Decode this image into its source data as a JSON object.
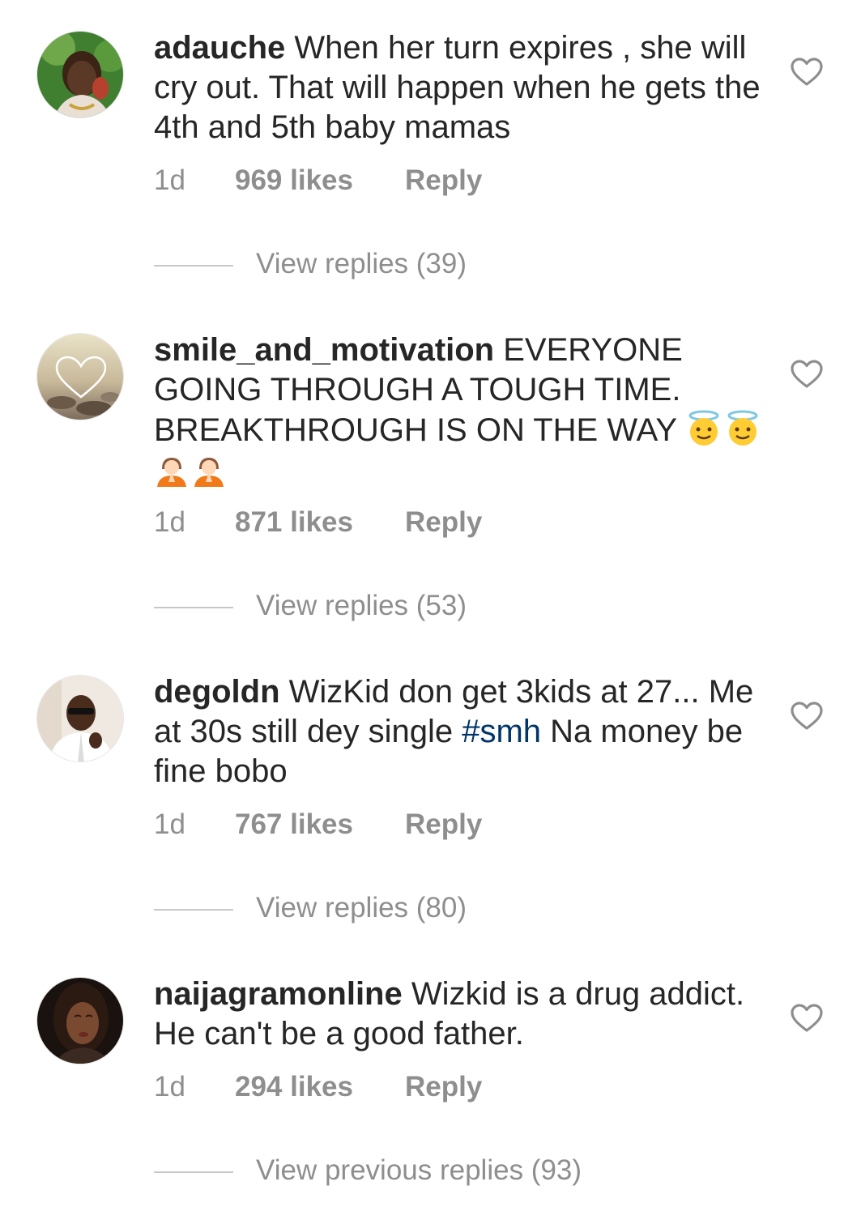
{
  "comments": [
    {
      "username": "adauche",
      "text": "When her turn expires , she will cry out. That will happen when he gets the 4th and 5th baby mamas",
      "time": "1d",
      "likes": "969 likes",
      "reply_label": "Reply",
      "view_replies": "View replies (39)"
    },
    {
      "username": "smile_and_motivation",
      "text": "EVERYONE GOING THROUGH A TOUGH TIME. BREAKTHROUGH IS ON THE WAY",
      "emojis": [
        "smiling-face-with-halo-emoji",
        "smiling-face-with-halo-emoji",
        "person-praying-emoji",
        "person-praying-emoji"
      ],
      "time": "1d",
      "likes": "871 likes",
      "reply_label": "Reply",
      "view_replies": "View replies (53)"
    },
    {
      "username": "degoldn",
      "text_before": "WizKid don get 3kids at 27... Me at 30s still dey single",
      "hashtag": "#smh",
      "text_after": "Na money be fine bobo",
      "time": "1d",
      "likes": "767 likes",
      "reply_label": "Reply",
      "view_replies": "View replies (80)"
    },
    {
      "username": "naijagramonline",
      "text": "Wizkid is a drug addict. He can't be a good father.",
      "time": "1d",
      "likes": "294 likes",
      "reply_label": "Reply",
      "view_replies": "View previous replies (93)"
    }
  ],
  "colors": {
    "text": "#262626",
    "secondary": "#8e8e8e",
    "hashtag": "#003569",
    "divider": "#c7c7c7"
  },
  "icons": {
    "like": "heart-outline-icon"
  }
}
